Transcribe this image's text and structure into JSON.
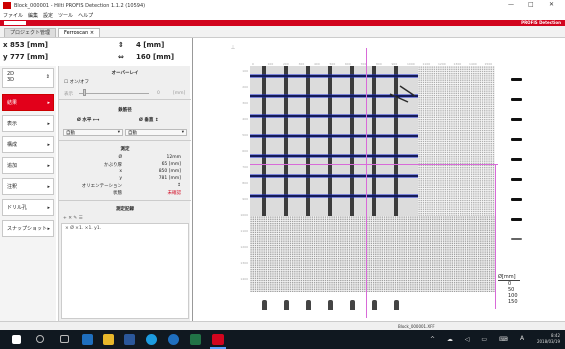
{
  "window": {
    "title": "Block_000001 - Hilti PROFIS Detection 1.1.2 (10594)",
    "minimize": "—",
    "maximize": "□",
    "close": "✕"
  },
  "menu": [
    "ファイル",
    "編集",
    "設定",
    "ツール",
    "ヘルプ"
  ],
  "brandbar": {
    "product": "PROFIS Detection"
  },
  "tabs": [
    {
      "label": "プロジェクト管理"
    },
    {
      "label": "Ferroscan"
    }
  ],
  "coords": {
    "x": "x  853 [mm]",
    "y": "y  777 [mm]",
    "dx": "4 [mm]",
    "dy": "160 [mm]"
  },
  "sidebar": {
    "view_2d": "2D",
    "view_3d": "3D",
    "items": [
      {
        "label": "結果"
      },
      {
        "label": "表示"
      },
      {
        "label": "構成"
      },
      {
        "label": "追加"
      },
      {
        "label": "注釈"
      },
      {
        "label": "ドリル孔"
      },
      {
        "label": "スナップショット"
      }
    ]
  },
  "panel": {
    "overlay_title": "オーバーレイ",
    "overlay_toggle": "オン/オフ",
    "slider_label": "表示",
    "slider_value": "0",
    "slider_unit": "[mm]",
    "diam_title": "鉄筋径",
    "diam_horizontal": "Ø 水平 ⟷",
    "diam_vertical": "Ø 垂直 ↕",
    "select_left": "自動",
    "select_right": "自動",
    "measure_title": "測定",
    "measurements": [
      {
        "label": "Ø",
        "value": "12mm"
      },
      {
        "label": "かぶり厚",
        "value": "65 [mm]"
      },
      {
        "label": "x",
        "value": "850 [mm]"
      },
      {
        "label": "y",
        "value": "781 [mm]"
      },
      {
        "label": "オリエンテーション",
        "value": "↕"
      },
      {
        "label": "状態",
        "value": "未確認"
      }
    ],
    "record_title": "測定記録",
    "record_tools": "+ ✕ ✎ ☰",
    "record_header": "× Ø   ×1.   ×1.   y1."
  },
  "ruler": {
    "x_ticks": [
      "0",
      "100",
      "200",
      "300",
      "400",
      "500",
      "600",
      "700",
      "800",
      "900",
      "1000",
      "1100",
      "1200",
      "1300",
      "1400",
      "1500"
    ],
    "y_ticks": [
      "100",
      "200",
      "300",
      "400",
      "500",
      "600",
      "700",
      "800",
      "900",
      "1000",
      "1100",
      "1200",
      "1300",
      "1400"
    ]
  },
  "legend": {
    "title": "Ø[mm]",
    "values": [
      "0",
      "50",
      "100",
      "150"
    ]
  },
  "status": {
    "file": "Block_000001.XFF"
  },
  "taskbar": {
    "time": "8:42",
    "date": "2018/03/19",
    "ime": "A"
  },
  "colors": {
    "hilti_red": "#d2051e",
    "rebar_blue": "#1b2ccf",
    "cursor_magenta": "#d86ad8",
    "taskbar": "#101820"
  }
}
